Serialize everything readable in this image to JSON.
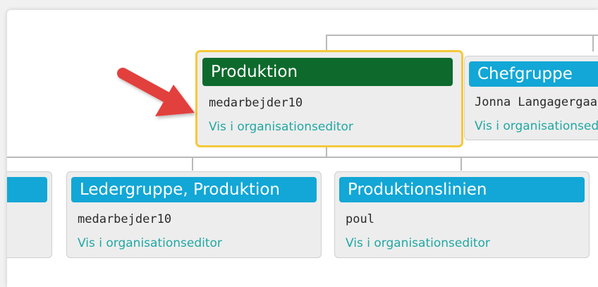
{
  "colors": {
    "selected_header": "#0e6a2c",
    "default_header": "#12a7d6",
    "link": "#21a8a3",
    "highlight_border": "#f5c93a",
    "arrow": "#e2403e"
  },
  "units": {
    "produktion": {
      "title": "Produktion",
      "user": "medarbejder10",
      "link": "Vis i organisationseditor"
    },
    "chefgruppe": {
      "title": "Chefgruppe",
      "user": "Jonna Langagergaard",
      "link": "Vis i organisationseditor"
    },
    "left_partial": {
      "title": "",
      "user": "",
      "link": ""
    },
    "ledergruppe": {
      "title": "Ledergruppe, Produktion",
      "user": "medarbejder10",
      "link": "Vis i organisationseditor"
    },
    "produktionslinien": {
      "title": "Produktionslinien",
      "user": "poul",
      "link": "Vis i organisationseditor"
    }
  }
}
